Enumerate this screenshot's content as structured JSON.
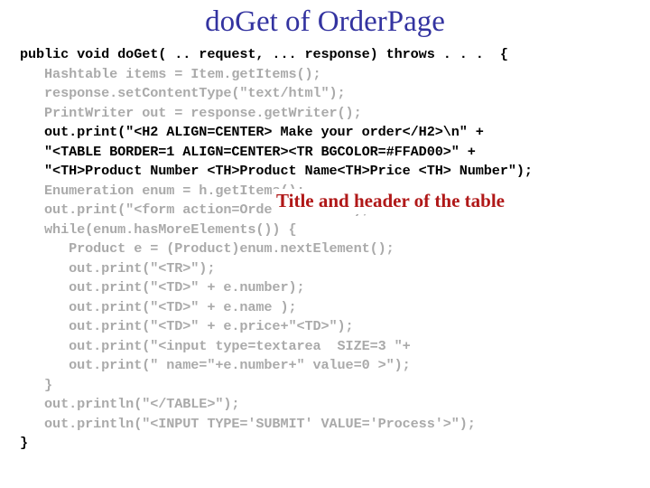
{
  "slide": {
    "title": "doGet of OrderPage",
    "title_color": "#3333A0",
    "background_color": "#FFFFFF"
  },
  "code": {
    "dim_color": "#AAAAAA",
    "highlight_color": "#000000",
    "lines": [
      {
        "text": "public void doGet( .. request, ... response) throws . . .  {",
        "emphasis": "highlight"
      },
      {
        "text": "   Hashtable items = Item.getItems();",
        "emphasis": "dim"
      },
      {
        "text": "   response.setContentType(\"text/html\");",
        "emphasis": "dim"
      },
      {
        "text": "   PrintWriter out = response.getWriter();",
        "emphasis": "dim"
      },
      {
        "text": "   out.print(\"<H2 ALIGN=CENTER> Make your order</H2>\\n\" +",
        "emphasis": "highlight"
      },
      {
        "text": "   \"<TABLE BORDER=1 ALIGN=CENTER><TR BGCOLOR=#FFAD00>\" +",
        "emphasis": "highlight"
      },
      {
        "text": "   \"<TH>Product Number <TH>Product Name<TH>Price <TH> Number\");",
        "emphasis": "highlight"
      },
      {
        "text": "   Enumeration enum = h.getItems();",
        "emphasis": "dim"
      },
      {
        "text": "   out.print(\"<form action=OrderProcess>\");",
        "emphasis": "dim"
      },
      {
        "text": "   while(enum.hasMoreElements()) {",
        "emphasis": "dim"
      },
      {
        "text": "      Product e = (Product)enum.nextElement();",
        "emphasis": "dim"
      },
      {
        "text": "      out.print(\"<TR>\");",
        "emphasis": "dim"
      },
      {
        "text": "      out.print(\"<TD>\" + e.number);",
        "emphasis": "dim"
      },
      {
        "text": "      out.print(\"<TD>\" + e.name );",
        "emphasis": "dim"
      },
      {
        "text": "      out.print(\"<TD>\" + e.price+\"<TD>\");",
        "emphasis": "dim"
      },
      {
        "text": "      out.print(\"<input type=textarea  SIZE=3 \"+",
        "emphasis": "dim"
      },
      {
        "text": "      out.print(\" name=\"+e.number+\" value=0 >\");",
        "emphasis": "dim"
      },
      {
        "text": "   }",
        "emphasis": "dim"
      },
      {
        "text": "   out.println(\"</TABLE>\");",
        "emphasis": "dim"
      },
      {
        "text": "   out.println(\"<INPUT TYPE='SUBMIT' VALUE='Process'>\");",
        "emphasis": "dim"
      },
      {
        "text": "}",
        "emphasis": "highlight"
      }
    ]
  },
  "annotations": [
    {
      "text": "Title and header of the table",
      "color": "#B01818"
    }
  ]
}
